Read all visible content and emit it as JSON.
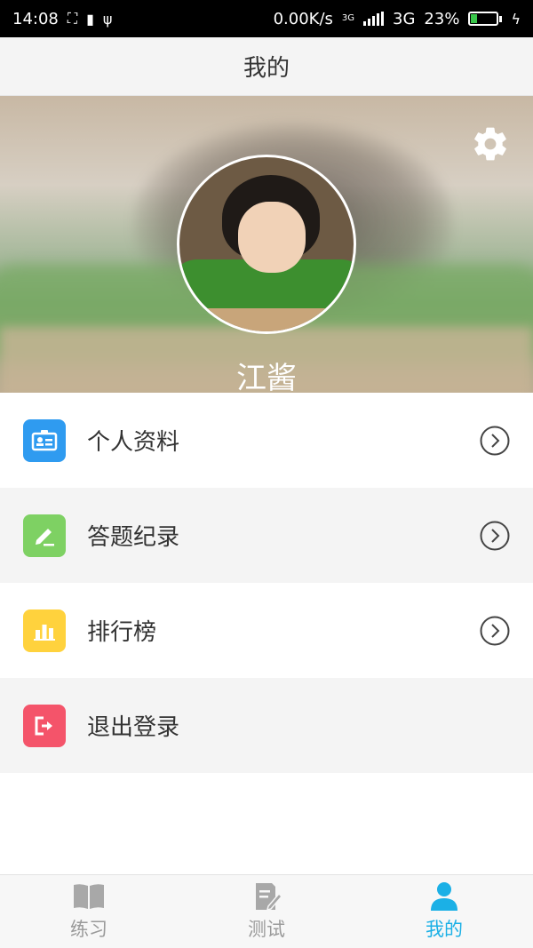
{
  "status_bar": {
    "time": "14:08",
    "network_speed": "0.00K/s",
    "network_type": "3G",
    "battery": "23%",
    "battery_level": 0.23,
    "small_network_label": "3G"
  },
  "title": "我的",
  "profile": {
    "username": "江酱"
  },
  "menu": [
    {
      "label": "个人资料",
      "icon": "id-card-icon",
      "color": "#2f9bf0"
    },
    {
      "label": "答题纪录",
      "icon": "pencil-icon",
      "color": "#7ed163"
    },
    {
      "label": "排行榜",
      "icon": "chart-icon",
      "color": "#ffd23d"
    },
    {
      "label": "退出登录",
      "icon": "logout-icon",
      "color": "#f4546a"
    }
  ],
  "bottom_nav": {
    "tabs": [
      {
        "label": "练习",
        "icon": "book-icon"
      },
      {
        "label": "测试",
        "icon": "document-pen-icon"
      },
      {
        "label": "我的",
        "icon": "person-icon"
      }
    ],
    "active_color": "#1bb0e6",
    "inactive_color": "#9a9a9a"
  }
}
